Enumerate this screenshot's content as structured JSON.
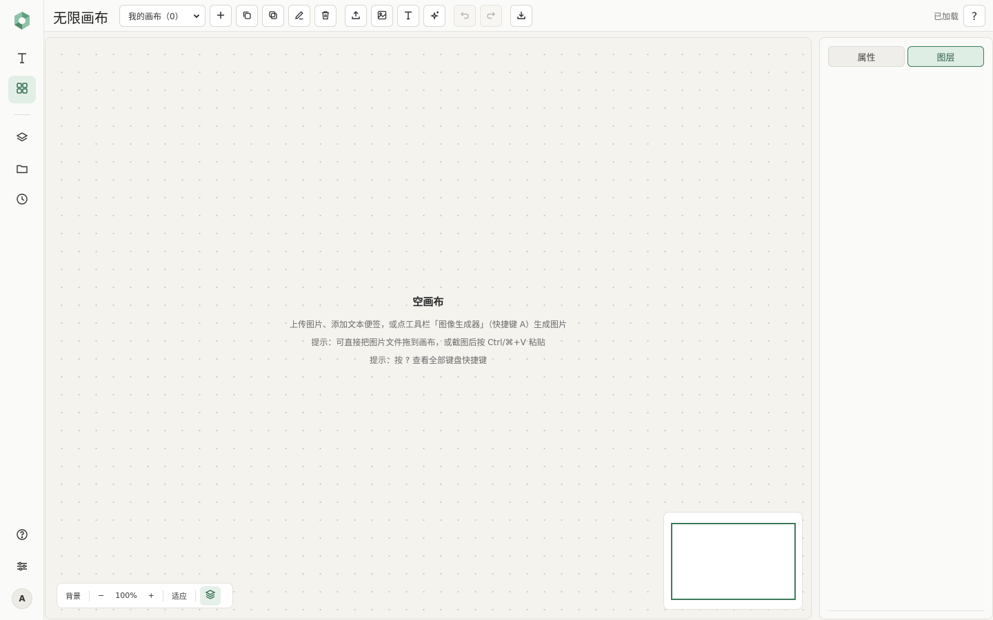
{
  "app": {
    "title": "无限画布",
    "status": "已加载"
  },
  "toolbar": {
    "canvas_select_value": "我的画布（0）",
    "buttons": [
      "add-icon",
      "duplicate-icon",
      "copy-icon",
      "edit-icon",
      "delete-icon",
      "upload-icon",
      "image-icon",
      "text-icon",
      "ai-sparkle-icon",
      "undo-icon",
      "redo-icon",
      "download-icon"
    ],
    "help_label": "?"
  },
  "rail": {
    "items": [
      "text-icon",
      "grid-icon",
      "layers-icon",
      "folder-icon",
      "history-icon",
      "help-circle-icon",
      "settings-sliders-icon"
    ],
    "active": "grid-icon",
    "avatar_letter": "A"
  },
  "canvas": {
    "empty_title": "空画布",
    "empty_lines": [
      "上传图片、添加文本便签，或点工具栏「图像生成器」（快捷键 A）生成图片",
      "提示：可直接把图片文件拖到画布，或截图后按 Ctrl/⌘+V 粘贴",
      "提示：按 ? 查看全部键盘快捷键"
    ]
  },
  "zoombar": {
    "background_label": "背景",
    "minus_label": "−",
    "zoom_level": "100%",
    "plus_label": "+",
    "fit_label": "适应"
  },
  "panel": {
    "tabs": [
      {
        "label": "属性",
        "active": false
      },
      {
        "label": "图层",
        "active": true
      }
    ]
  },
  "colors": {
    "accent": "#3c7a5a",
    "accent_bg": "#e2efe7",
    "canvas_bg": "#f4f3ee"
  }
}
